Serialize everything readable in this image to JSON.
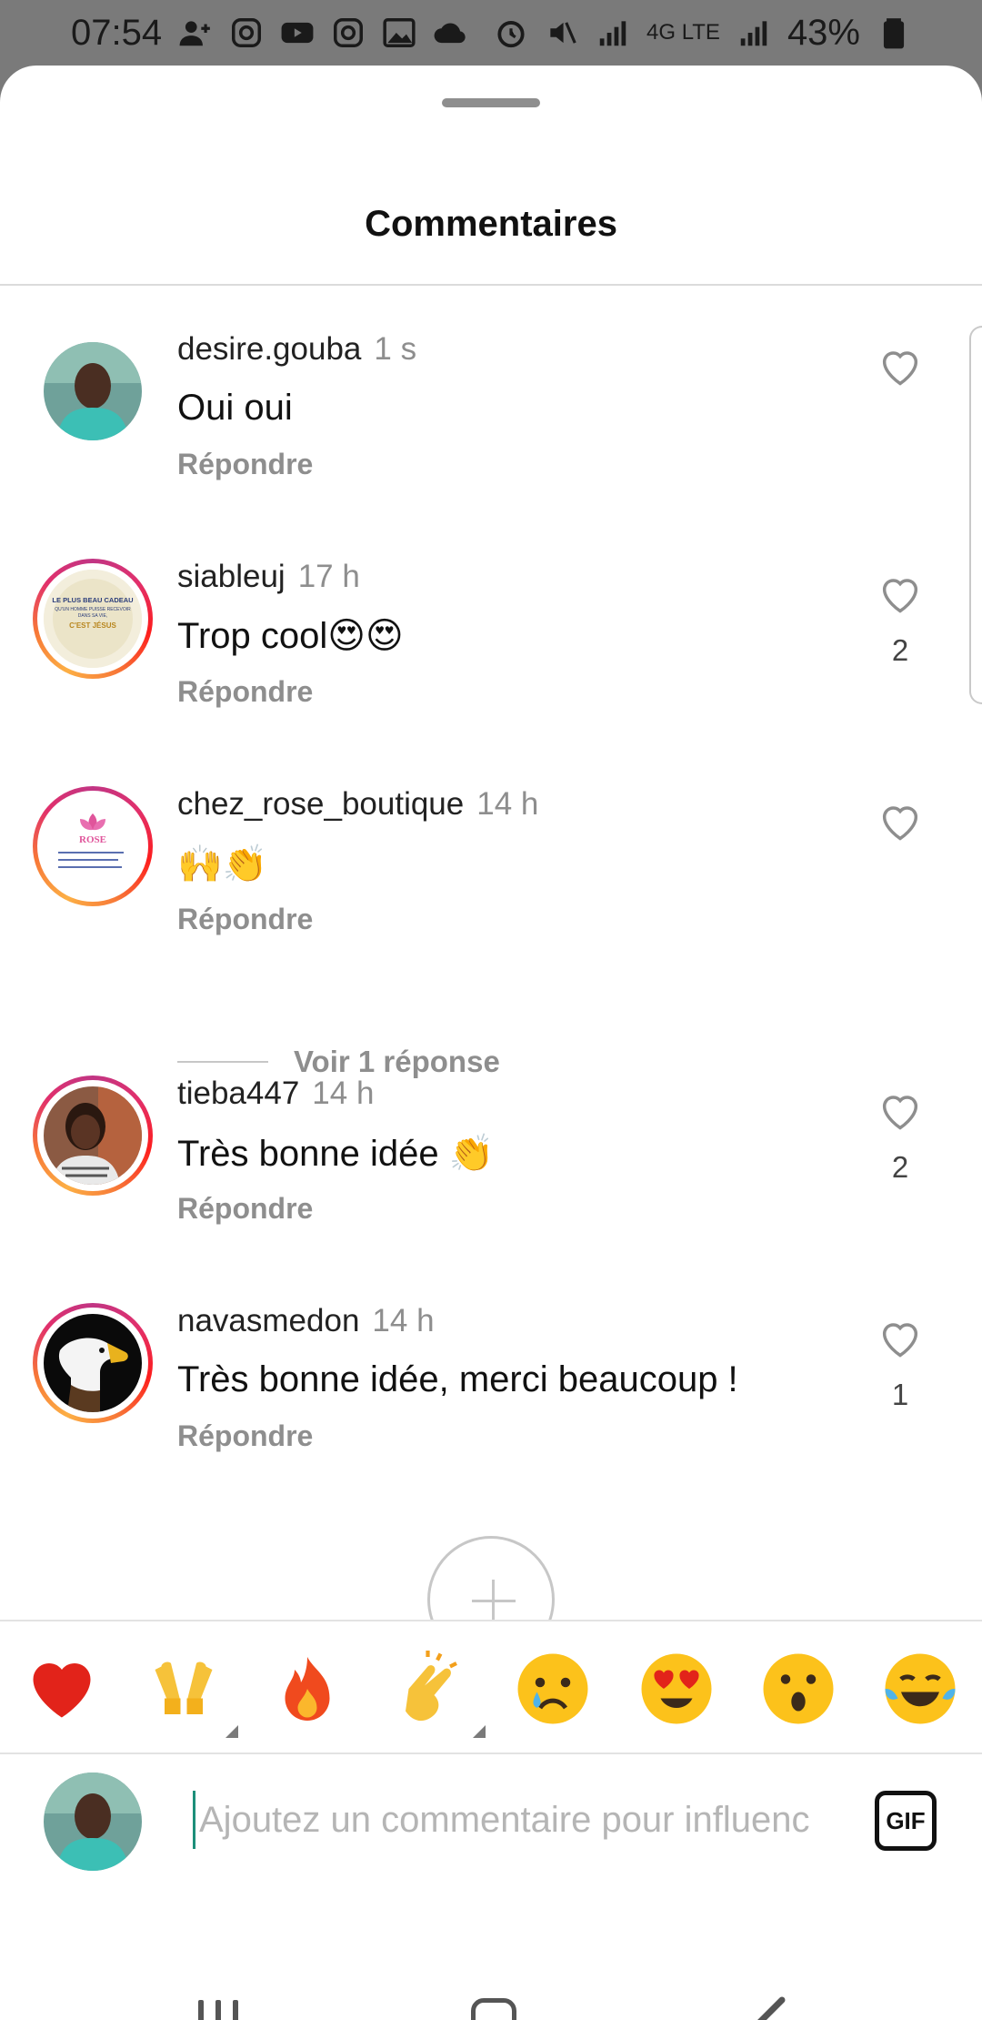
{
  "status_bar": {
    "time": "07:54",
    "battery": "43%",
    "network": "4G LTE"
  },
  "sheet": {
    "title": "Commentaires"
  },
  "comments": [
    {
      "username": "desire.gouba",
      "time": "1 s",
      "text": "Oui oui",
      "reply_label": "Répondre",
      "likes": ""
    },
    {
      "username": "siableuj",
      "time": "17 h",
      "text": "Trop cool😍😍",
      "reply_label": "Répondre",
      "likes": "2"
    },
    {
      "username": "chez_rose_boutique",
      "time": "14 h",
      "text": "🙌👏",
      "reply_label": "Répondre",
      "likes": ""
    },
    {
      "username": "tieba447",
      "time": "14 h",
      "text": "Très bonne idée 👏",
      "reply_label": "Répondre",
      "likes": "2"
    },
    {
      "username": "navasmedon",
      "time": "14 h",
      "text": "Très bonne idée, merci beaucoup !",
      "reply_label": "Répondre",
      "likes": "1"
    }
  ],
  "view_replies": "Voir 1 réponse",
  "avatar_texts": {
    "siableuj": [
      "LE PLUS BEAU CADEAU",
      "QU'UN HOMME PUISSE RECEVOIR",
      "DANS SA VIE,",
      "C'EST JÉSUS"
    ],
    "chez_rose_boutique": "ROSE"
  },
  "emoji_bar": [
    {
      "name": "heart",
      "emoji": "❤️"
    },
    {
      "name": "raising-hands",
      "emoji": "🙌"
    },
    {
      "name": "fire",
      "emoji": "🔥"
    },
    {
      "name": "clapping-hands",
      "emoji": "👏"
    },
    {
      "name": "crying-face",
      "emoji": "😢"
    },
    {
      "name": "heart-eyes",
      "emoji": "😍"
    },
    {
      "name": "surprised-face",
      "emoji": "😮"
    },
    {
      "name": "tears-of-joy",
      "emoji": "😂"
    }
  ],
  "input": {
    "placeholder": "Ajoutez un commentaire pour influenc",
    "gif_label": "GIF"
  },
  "colors": {
    "story_ring": "#e1306c",
    "muted_text": "#8e8e8e",
    "cursor": "#1d8f7a"
  }
}
